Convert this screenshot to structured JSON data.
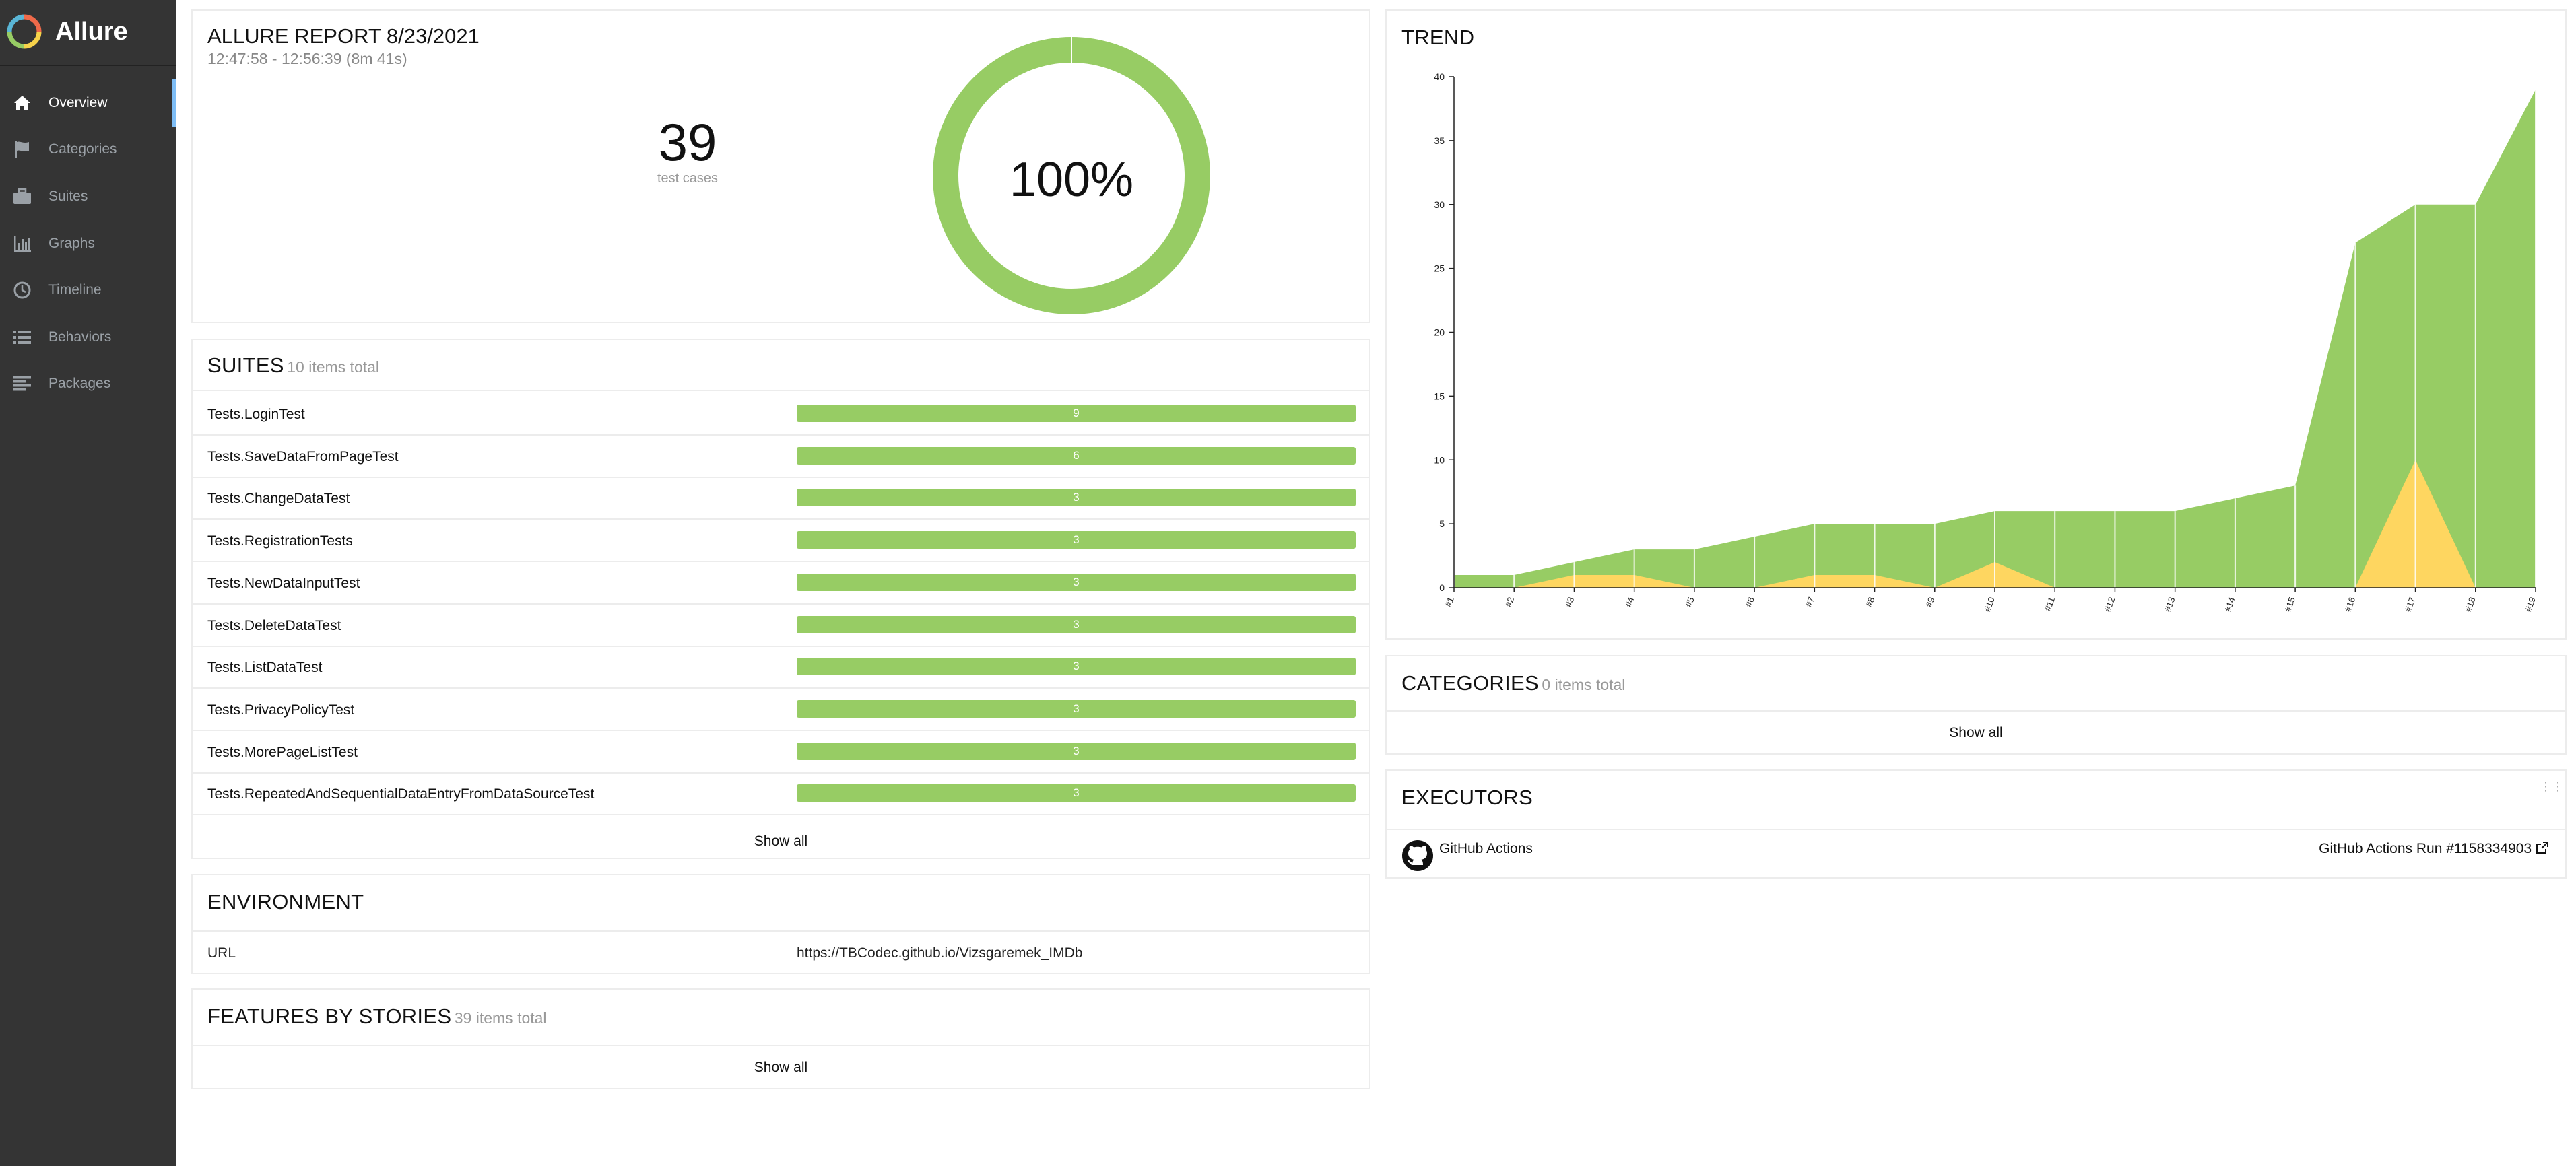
{
  "app": {
    "name": "Allure"
  },
  "sidebar": {
    "items": [
      {
        "label": "Overview",
        "icon": "home-icon",
        "active": true
      },
      {
        "label": "Categories",
        "icon": "flag-icon",
        "active": false
      },
      {
        "label": "Suites",
        "icon": "briefcase-icon",
        "active": false
      },
      {
        "label": "Graphs",
        "icon": "bar-chart-icon",
        "active": false
      },
      {
        "label": "Timeline",
        "icon": "clock-icon",
        "active": false
      },
      {
        "label": "Behaviors",
        "icon": "list-icon",
        "active": false
      },
      {
        "label": "Packages",
        "icon": "align-left-icon",
        "active": false
      }
    ]
  },
  "summary": {
    "title": "ALLURE REPORT 8/23/2021",
    "time_range": "12:47:58 - 12:56:39 (8m 41s)",
    "test_count": "39",
    "test_count_label": "test cases",
    "pass_rate": "100%",
    "pass_fraction": 1.0,
    "colors": {
      "passed": "#97cc64"
    }
  },
  "suites": {
    "title": "SUITES",
    "subtitle": "10 items total",
    "items": [
      {
        "name": "Tests.LoginTest",
        "passed": "9"
      },
      {
        "name": "Tests.SaveDataFromPageTest",
        "passed": "6"
      },
      {
        "name": "Tests.ChangeDataTest",
        "passed": "3"
      },
      {
        "name": "Tests.RegistrationTests",
        "passed": "3"
      },
      {
        "name": "Tests.NewDataInputTest",
        "passed": "3"
      },
      {
        "name": "Tests.DeleteDataTest",
        "passed": "3"
      },
      {
        "name": "Tests.ListDataTest",
        "passed": "3"
      },
      {
        "name": "Tests.PrivacyPolicyTest",
        "passed": "3"
      },
      {
        "name": "Tests.MorePageListTest",
        "passed": "3"
      },
      {
        "name": "Tests.RepeatedAndSequentialDataEntryFromDataSourceTest",
        "passed": "3"
      }
    ],
    "show_all": "Show all"
  },
  "environment": {
    "title": "ENVIRONMENT",
    "rows": [
      {
        "key": "URL",
        "value": "https://TBCodec.github.io/Vizsgaremek_IMDb"
      }
    ]
  },
  "features": {
    "title": "FEATURES BY STORIES",
    "subtitle": "39 items total",
    "show_all": "Show all"
  },
  "trend": {
    "title": "TREND"
  },
  "chart_data": {
    "type": "area",
    "title": "TREND",
    "x": [
      "#1",
      "#2",
      "#3",
      "#4",
      "#5",
      "#6",
      "#7",
      "#8",
      "#9",
      "#10",
      "#11",
      "#12",
      "#13",
      "#14",
      "#15",
      "#16",
      "#17",
      "#18",
      "#19"
    ],
    "series": [
      {
        "name": "passed",
        "color": "#97cc64",
        "values": [
          1,
          1,
          1,
          2,
          3,
          4,
          4,
          4,
          5,
          4,
          6,
          6,
          6,
          7,
          8,
          27,
          20,
          30,
          39
        ]
      },
      {
        "name": "broken",
        "color": "#fed660",
        "values": [
          0,
          0,
          1,
          1,
          0,
          0,
          1,
          1,
          0,
          2,
          0,
          0,
          0,
          0,
          0,
          0,
          10,
          0,
          0
        ]
      }
    ],
    "ylim": [
      0,
      40
    ],
    "yticks": [
      0,
      5,
      10,
      15,
      20,
      25,
      30,
      35,
      40
    ],
    "grid": "vertical"
  },
  "categories": {
    "title": "CATEGORIES",
    "subtitle": "0 items total",
    "show_all": "Show all"
  },
  "executors": {
    "title": "EXECUTORS",
    "name": "GitHub Actions",
    "run": "GitHub Actions Run #1158334903"
  }
}
